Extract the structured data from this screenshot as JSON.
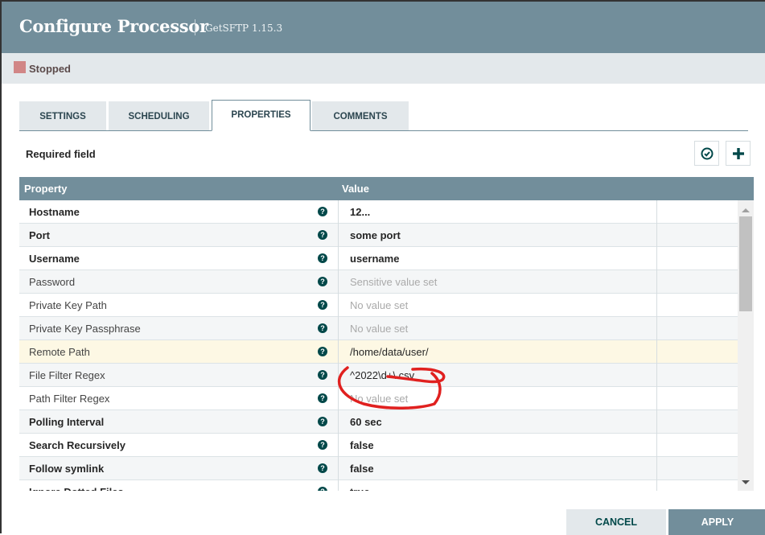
{
  "dialog": {
    "title": "Configure Processor",
    "subtitle": "GetSFTP 1.15.3",
    "status": "Stopped",
    "status_color": "#d18686"
  },
  "tabs": [
    {
      "label": "SETTINGS",
      "active": false
    },
    {
      "label": "SCHEDULING",
      "active": false
    },
    {
      "label": "PROPERTIES",
      "active": true
    },
    {
      "label": "COMMENTS",
      "active": false
    }
  ],
  "properties_panel": {
    "required_label": "Required field",
    "verify_icon": "check-circle-icon",
    "add_icon": "plus-icon",
    "columns": {
      "property": "Property",
      "value": "Value"
    },
    "rows": [
      {
        "name": "Hostname",
        "required": true,
        "value": "12...",
        "value_state": "set"
      },
      {
        "name": "Port",
        "required": true,
        "value": "some port",
        "value_state": "set"
      },
      {
        "name": "Username",
        "required": true,
        "value": "username",
        "value_state": "set"
      },
      {
        "name": "Password",
        "required": false,
        "value": "Sensitive value set",
        "value_state": "placeholder"
      },
      {
        "name": "Private Key Path",
        "required": false,
        "value": "No value set",
        "value_state": "placeholder"
      },
      {
        "name": "Private Key Passphrase",
        "required": false,
        "value": "No value set",
        "value_state": "placeholder"
      },
      {
        "name": "Remote Path",
        "required": false,
        "value": "/home/data/user/",
        "value_state": "set-optional",
        "highlighted": true
      },
      {
        "name": "File Filter Regex",
        "required": false,
        "value": "^2022\\d+\\.csv",
        "value_state": "set-optional"
      },
      {
        "name": "Path Filter Regex",
        "required": false,
        "value": "No value set",
        "value_state": "placeholder"
      },
      {
        "name": "Polling Interval",
        "required": true,
        "value": "60 sec",
        "value_state": "set"
      },
      {
        "name": "Search Recursively",
        "required": true,
        "value": "false",
        "value_state": "set"
      },
      {
        "name": "Follow symlink",
        "required": true,
        "value": "false",
        "value_state": "set"
      },
      {
        "name": "Ignore Dotted Files",
        "required": true,
        "value": "true",
        "value_state": "set"
      }
    ]
  },
  "footer": {
    "cancel_label": "CANCEL",
    "apply_label": "APPLY"
  },
  "colors": {
    "header_bg": "#728e9b",
    "accent": "#004849",
    "highlight_row": "#fdf8e4",
    "annotation": "#e0201f"
  }
}
